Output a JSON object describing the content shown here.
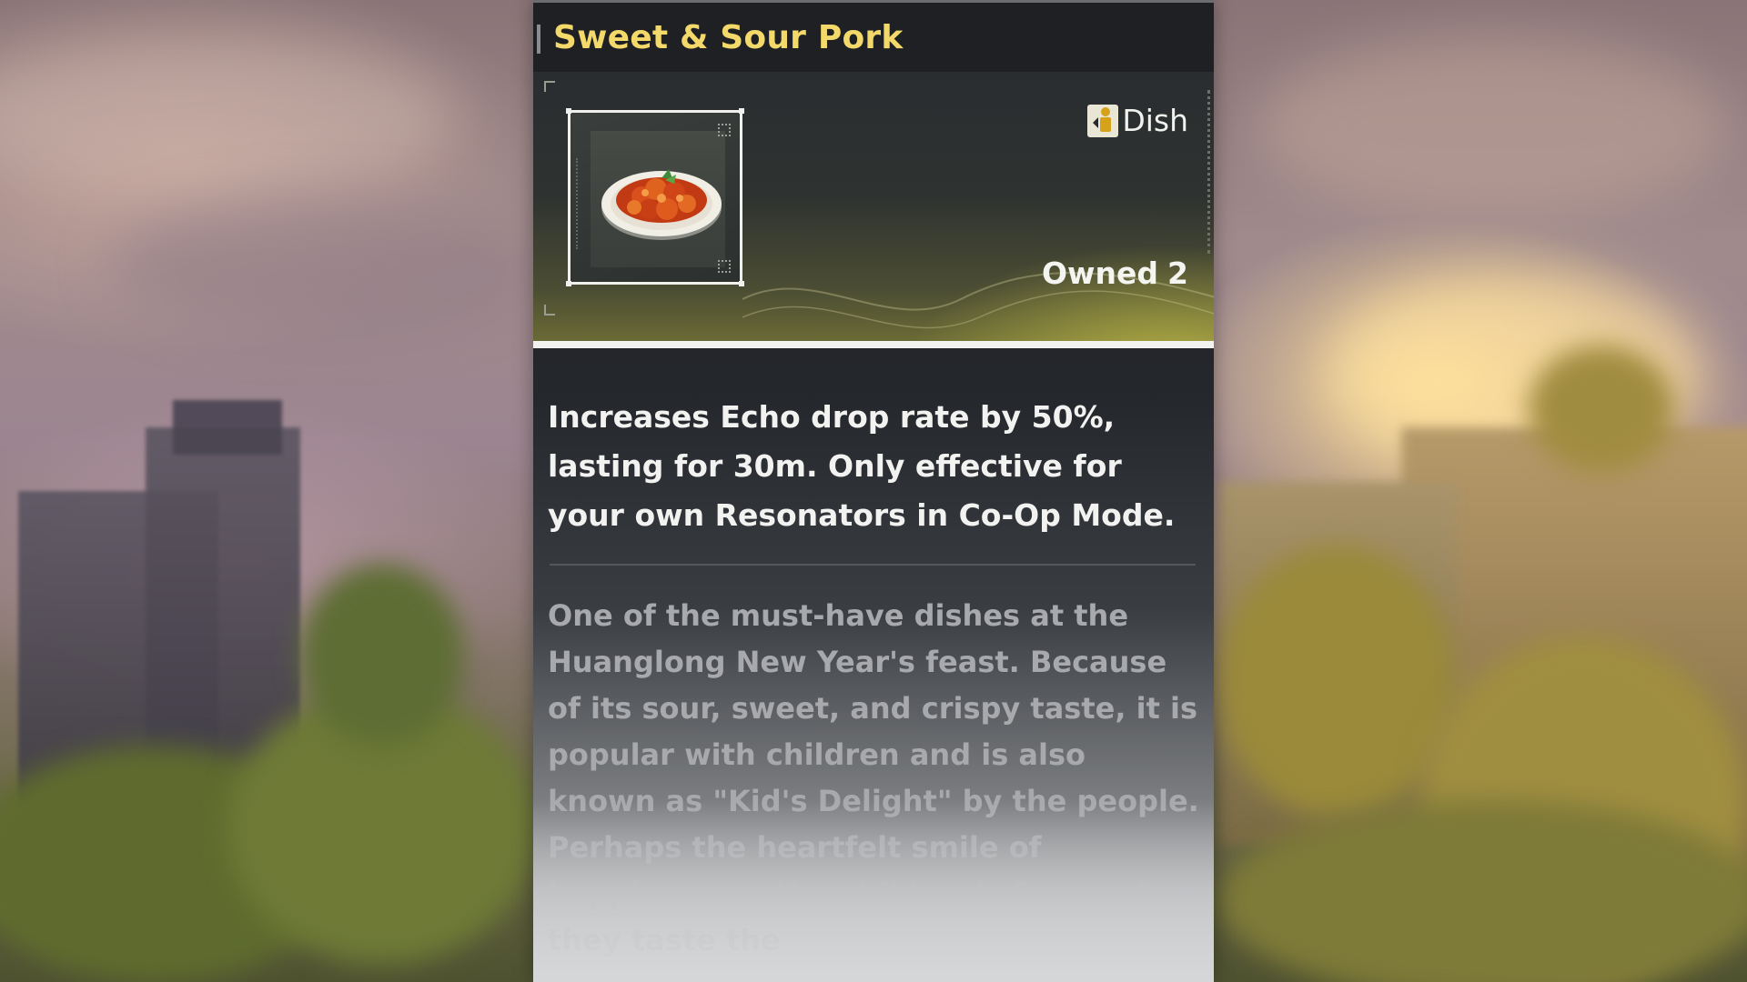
{
  "item": {
    "title": "Sweet & Sour Pork",
    "type_label": "Dish",
    "type_icon": "dish-type-icon",
    "owned_label": "Owned",
    "owned_count": "2",
    "item_icon": "sweet-sour-pork-icon",
    "effect": "Increases Echo drop rate by 50%, lasting for 30m. Only effective for your own Resonators in Co-Op Mode.",
    "lore": "One of the must-have dishes at the Huanglong New Year's feast. Because of its sour, sweet, and crispy taste, it is popular with children and is also known as \"Kid's Delight\" by the people. Perhaps the heartfelt smile of happiness on the children’s faces when they taste the"
  },
  "colors": {
    "title": "#f3d86a",
    "panel_dark": "#1f2126",
    "effect_text": "#f2f2f0",
    "lore_text": "#a7a9ac"
  }
}
